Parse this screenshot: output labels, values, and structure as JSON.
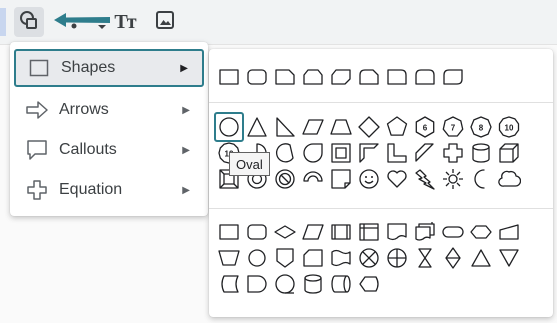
{
  "toolbar": {
    "items": [
      {
        "name": "shapes-icon"
      },
      {
        "name": "arrow-pointer-icon"
      },
      {
        "name": "text-box-icon",
        "glyph": "Tт"
      },
      {
        "name": "image-icon"
      }
    ],
    "active_color": "#dcdfe3"
  },
  "menu": {
    "items": [
      {
        "label": "Shapes",
        "icon": "square-icon",
        "arrow": "▶",
        "selected": true
      },
      {
        "label": "Arrows",
        "icon": "arrow-right-icon",
        "arrow": "▶"
      },
      {
        "label": "Callouts",
        "icon": "speech-bubble-icon",
        "arrow": "▶"
      },
      {
        "label": "Equation",
        "icon": "plus-icon",
        "arrow": "▶"
      }
    ],
    "highlight_color": "#2e7d8c"
  },
  "submenu": {
    "shapes_row": [
      "rectangle",
      "rounded-rectangle",
      "snip-corner-rectangle",
      "snip-same-side-rectangle",
      "snip-diagonal-rectangle",
      "round-snip-rectangle",
      "round-corner-rectangle",
      "round-same-side-rectangle",
      "round-diagonal-rectangle"
    ],
    "basic_shapes": [
      "oval",
      "triangle",
      "right-triangle",
      "parallelogram",
      "trapezoid",
      "diamond",
      "pentagon",
      "hexagon",
      "heptagon",
      "octagon",
      "decagon",
      "dodecagon",
      "pie",
      "chord",
      "teardrop",
      "frame",
      "half-frame",
      "corner",
      "diagonal-stripe",
      "plus",
      "can",
      "cube",
      "bevel",
      "donut",
      "no-symbol",
      "block-arc",
      "folded-corner",
      "smiley",
      "heart",
      "lightning-bolt",
      "sun",
      "moon",
      "cloud"
    ],
    "flowchart_shapes": [
      "process",
      "alternate-process",
      "decision",
      "data",
      "predefined-process",
      "internal-storage",
      "document",
      "multi-document",
      "terminator",
      "preparation",
      "manual-input",
      "manual-operation",
      "connector",
      "off-page-connector",
      "card",
      "punched-tape",
      "summing-junction",
      "or",
      "collate",
      "sort",
      "extract",
      "merge",
      "stored-data",
      "delay",
      "sequential-access",
      "magnetic-disk",
      "direct-access-storage",
      "display"
    ],
    "polygon_numbers": [
      "6",
      "7",
      "8",
      "10",
      "12"
    ],
    "hovered": "oval"
  },
  "tooltip": {
    "text": "Oval"
  }
}
